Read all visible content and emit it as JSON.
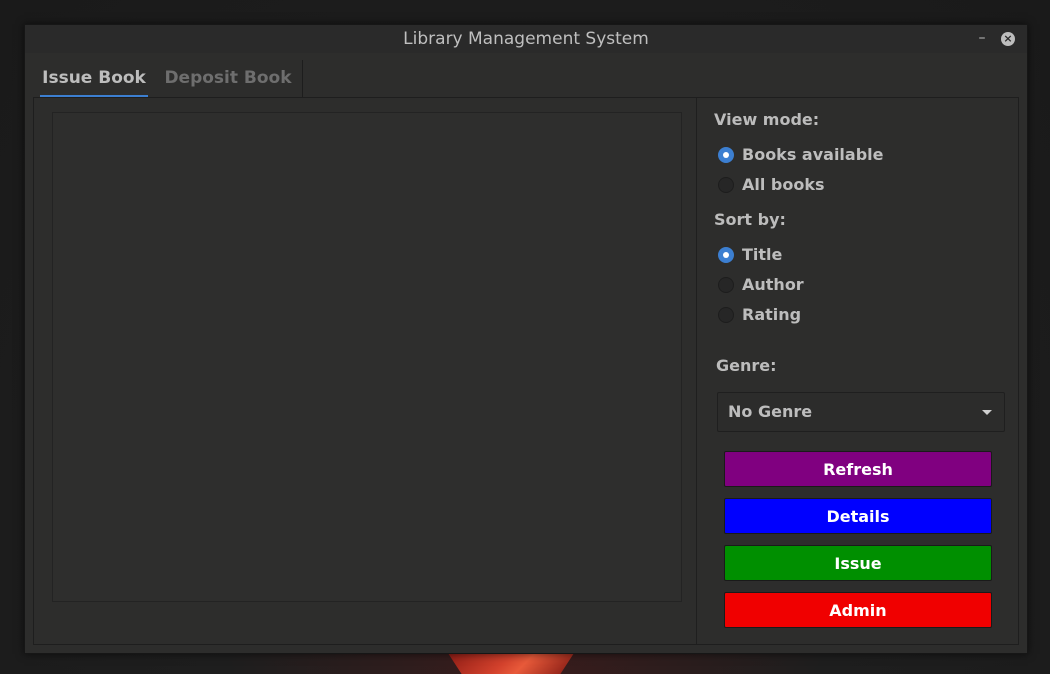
{
  "window": {
    "title": "Library Management System",
    "minimize_glyph": "–",
    "close_glyph": "×"
  },
  "tabs": [
    {
      "label": "Issue Book",
      "active": true
    },
    {
      "label": "Deposit Book",
      "active": false
    }
  ],
  "view_mode": {
    "label": "View mode:",
    "options": [
      {
        "label": "Books available",
        "checked": true
      },
      {
        "label": "All books",
        "checked": false
      }
    ]
  },
  "sort_by": {
    "label": "Sort by:",
    "options": [
      {
        "label": "Title",
        "checked": true
      },
      {
        "label": "Author",
        "checked": false
      },
      {
        "label": "Rating",
        "checked": false
      }
    ]
  },
  "genre": {
    "label": "Genre:",
    "selected": "No Genre"
  },
  "buttons": {
    "refresh": {
      "label": "Refresh",
      "color": "#800080"
    },
    "details": {
      "label": "Details",
      "color": "#0000ff"
    },
    "issue": {
      "label": "Issue",
      "color": "#008f00"
    },
    "admin": {
      "label": "Admin",
      "color": "#f00000"
    }
  },
  "colors": {
    "accent": "#3c7fd1",
    "window_bg": "#2d2d2c"
  }
}
